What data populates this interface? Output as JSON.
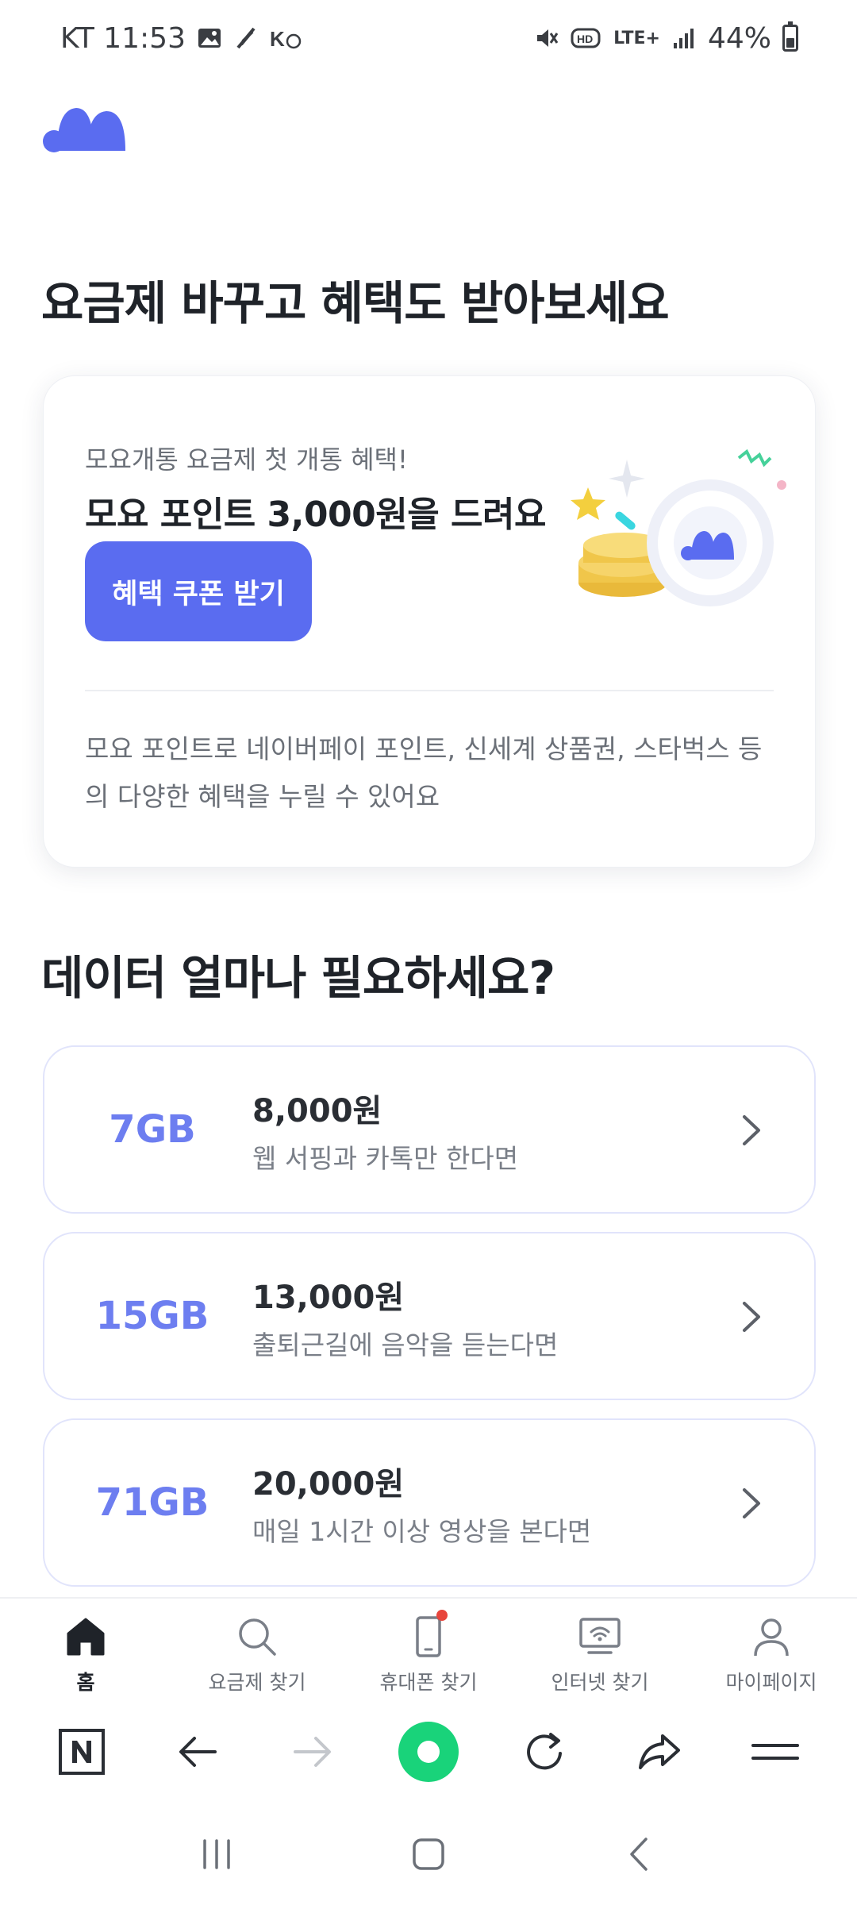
{
  "status_bar": {
    "carrier_time": "KT 11:53",
    "network": "LTE+",
    "battery": "44%"
  },
  "main": {
    "title": "요금제 바꾸고 혜택도 받아보세요",
    "promo": {
      "subtitle": "모요개통 요금제 첫 개통 혜택!",
      "title": "모요 포인트 3,000원을 드려요",
      "button": "혜택 쿠폰 받기",
      "description": "모요 포인트로 네이버페이 포인트, 신세계 상품권, 스타벅스 등의 다양한 혜택을 누릴 수 있어요"
    },
    "data_title": "데이터 얼마나 필요하세요?",
    "plans": [
      {
        "gb": "7GB",
        "price": "8,000원",
        "desc": "웹 서핑과 카톡만 한다면"
      },
      {
        "gb": "15GB",
        "price": "13,000원",
        "desc": "출퇴근길에 음악을 듣는다면"
      },
      {
        "gb": "71GB",
        "price": "20,000원",
        "desc": "매일 1시간 이상 영상을 본다면"
      }
    ]
  },
  "bottom_nav": [
    {
      "label": "홈",
      "icon": "home-icon",
      "active": true
    },
    {
      "label": "요금제 찾기",
      "icon": "search-icon"
    },
    {
      "label": "휴대폰 찾기",
      "icon": "phone-icon"
    },
    {
      "label": "인터넷 찾기",
      "icon": "wifi-monitor-icon"
    },
    {
      "label": "마이페이지",
      "icon": "person-icon"
    }
  ],
  "browser_toolbar": {
    "icons": [
      "naver-icon",
      "back-arrow-icon",
      "forward-arrow-icon",
      "green-dot-icon",
      "refresh-icon",
      "share-icon",
      "menu-icon"
    ]
  },
  "colors": {
    "accent": "#5a6cf0",
    "plan_gb": "#6d7ef0",
    "plan_border": "#e1e4fb",
    "green": "#19d37a",
    "badge_red": "#e8453c"
  }
}
